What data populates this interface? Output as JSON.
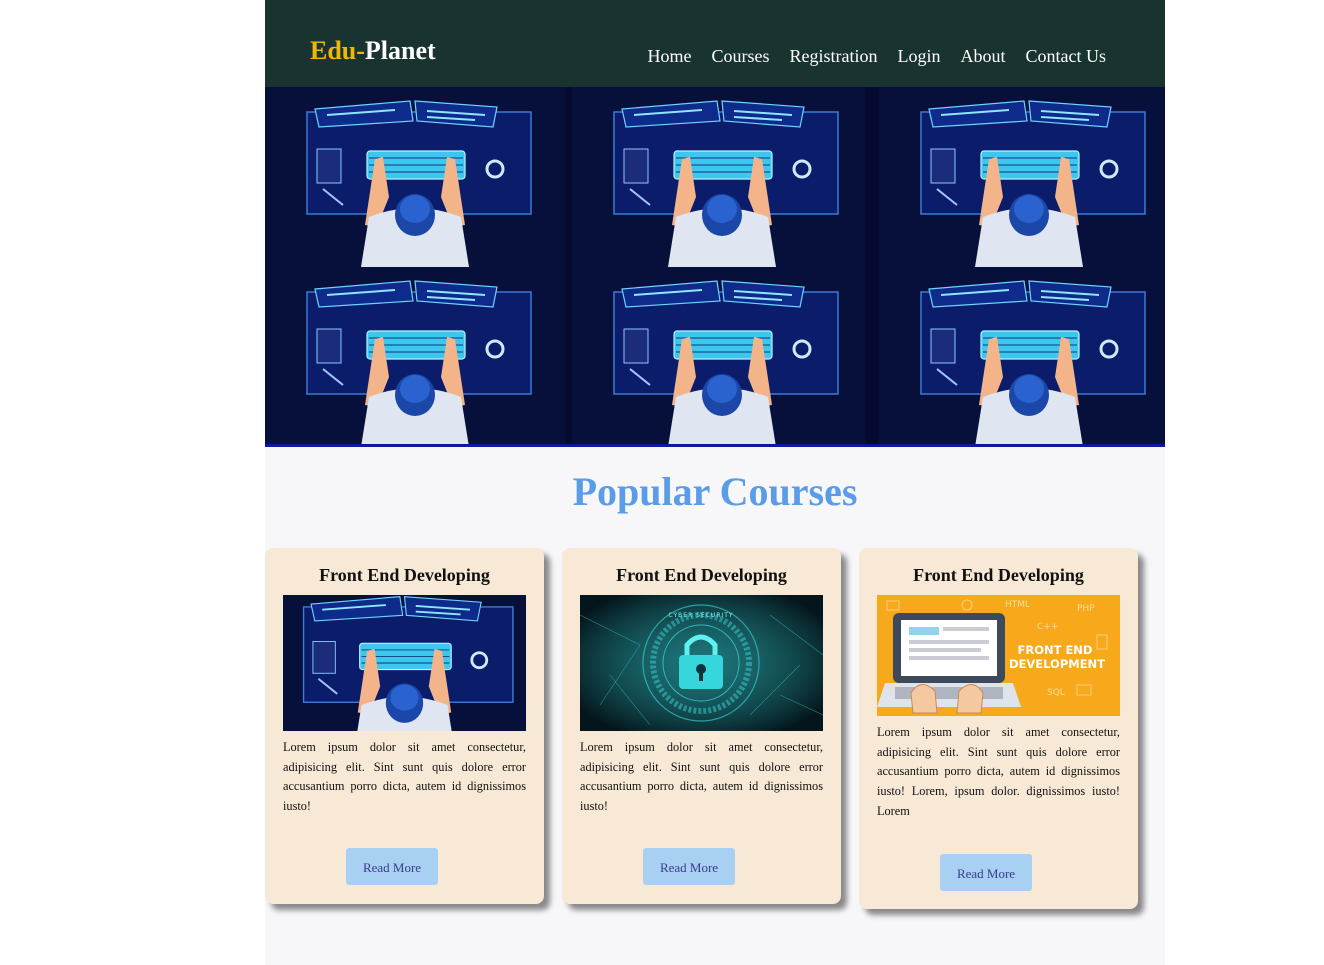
{
  "brand": {
    "part1": "Edu-",
    "part2": "Planet",
    "accent_color": "#f2b705"
  },
  "nav": {
    "items": [
      {
        "label": "Home"
      },
      {
        "label": "Courses"
      },
      {
        "label": "Registration"
      },
      {
        "label": "Login"
      },
      {
        "label": "About"
      },
      {
        "label": "Contact Us"
      }
    ]
  },
  "hero": {
    "image": "developer-desk-pattern"
  },
  "section": {
    "title": "Popular Courses",
    "title_color": "#5b9ce8"
  },
  "cards": [
    {
      "title": "Front End Developing",
      "image": "developer-desk-image",
      "text": "Lorem ipsum dolor sit amet consectetur, adipisicing elit. Sint sunt quis dolore error accusantium porro dicta, autem id dignissimos iusto!",
      "button": "Read More"
    },
    {
      "title": "Front End Developing",
      "image": "cyber-security-lock-image",
      "image_text": "CYBER SECURITY",
      "text": "Lorem ipsum dolor sit amet consectetur, adipisicing elit. Sint sunt quis dolore error accusantium porro dicta, autem id dignissimos iusto!",
      "button": "Read More"
    },
    {
      "title": "Front End Developing",
      "image": "front-end-development-laptop-image",
      "image_text": "FRONT END DEVELOPMENT",
      "image_keywords": [
        "HTML",
        "PHP",
        "C++",
        "SQL"
      ],
      "text": "Lorem ipsum dolor sit amet consectetur, adipisicing elit. Sint sunt quis dolore error accusantium porro dicta, autem id dignissimos iusto! Lorem, ipsum dolor. dignissimos iusto! Lorem",
      "button": "Read More"
    }
  ]
}
